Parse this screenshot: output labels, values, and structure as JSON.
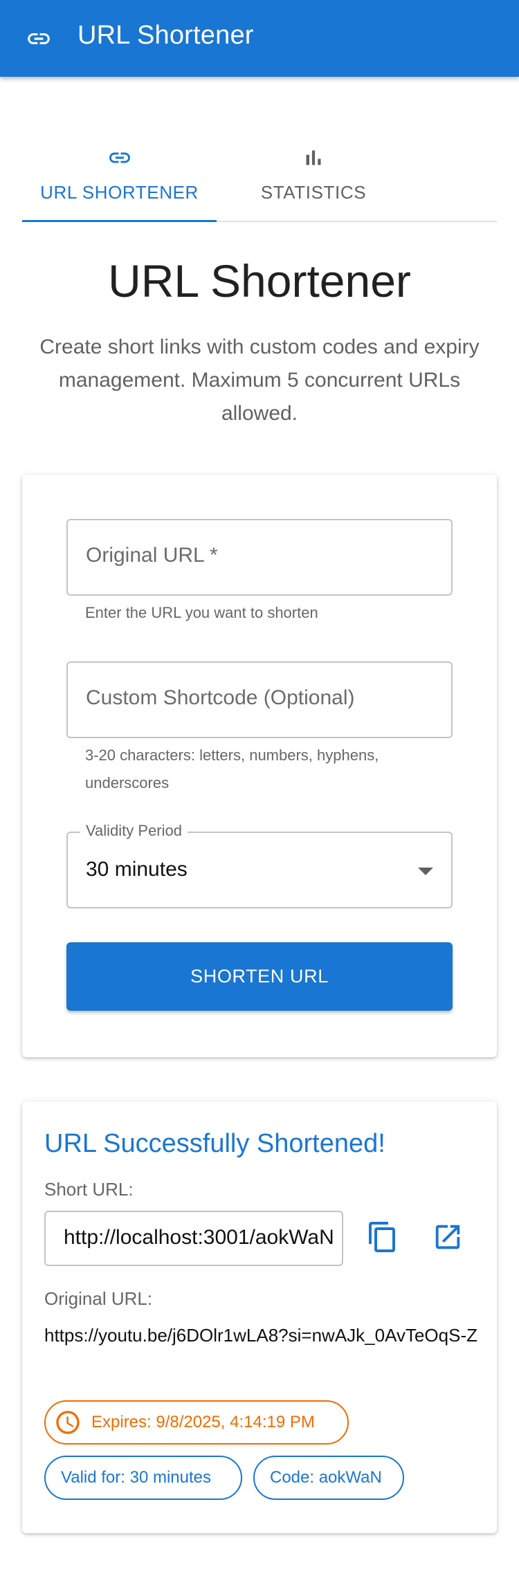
{
  "appbar": {
    "title": "URL Shortener",
    "icon": "link-icon"
  },
  "tabs": [
    {
      "label": "URL SHORTENER",
      "icon": "link-icon",
      "active": true
    },
    {
      "label": "STATISTICS",
      "icon": "bar-chart-icon",
      "active": false
    }
  ],
  "main": {
    "title": "URL Shortener",
    "description": "Create short links with custom codes and expiry management. Maximum 5 concurrent URLs allowed."
  },
  "form": {
    "original_url": {
      "placeholder": "Original URL *",
      "value": "",
      "helper": "Enter the URL you want to shorten"
    },
    "shortcode": {
      "placeholder": "Custom Shortcode (Optional)",
      "value": "",
      "helper": "3-20 characters: letters, numbers, hyphens, underscores"
    },
    "validity": {
      "label": "Validity Period",
      "value": "30 minutes"
    },
    "submit_label": "SHORTEN URL"
  },
  "result": {
    "title": "URL Successfully Shortened!",
    "short_url_label": "Short URL:",
    "short_url": "http://localhost:3001/aokWaN",
    "original_url_label": "Original URL:",
    "original_url": "https://youtu.be/j6DOlr1wLA8?si=nwAJk_0AvTeOqS-Z",
    "expires": "Expires: 9/8/2025, 4:14:19 PM",
    "valid_for": "Valid for: 30 minutes",
    "code": "Code: aokWaN"
  },
  "colors": {
    "primary": "#1976d2",
    "warning": "#ef6c00",
    "text_secondary": "#616161"
  }
}
